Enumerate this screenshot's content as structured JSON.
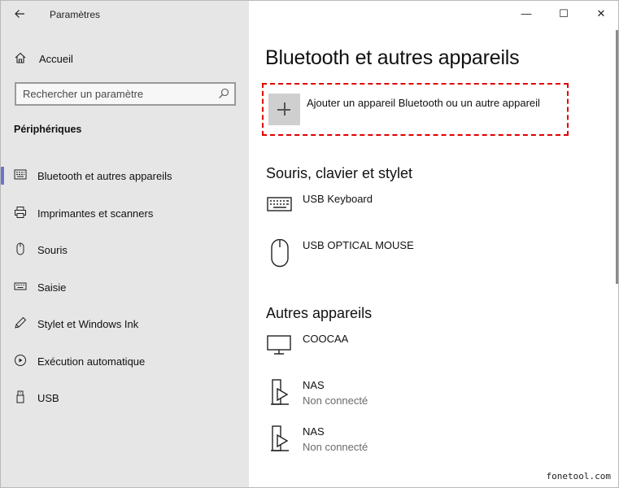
{
  "window": {
    "app_title": "Paramètres",
    "controls": {
      "minimize": "—",
      "maximize": "☐",
      "close": "✕"
    }
  },
  "sidebar": {
    "home_label": "Accueil",
    "search_placeholder": "Rechercher un paramètre",
    "section_label": "Périphériques",
    "items": [
      {
        "label": "Bluetooth et autres appareils",
        "icon": "bluetooth-devices-icon",
        "active": true
      },
      {
        "label": "Imprimantes et scanners",
        "icon": "printer-icon",
        "active": false
      },
      {
        "label": "Souris",
        "icon": "mouse-icon",
        "active": false
      },
      {
        "label": "Saisie",
        "icon": "keyboard-icon",
        "active": false
      },
      {
        "label": "Stylet et Windows Ink",
        "icon": "pen-icon",
        "active": false
      },
      {
        "label": "Exécution automatique",
        "icon": "autoplay-icon",
        "active": false
      },
      {
        "label": "USB",
        "icon": "usb-icon",
        "active": false
      }
    ],
    "active_color": "#6b75c9"
  },
  "main": {
    "title": "Bluetooth et autres appareils",
    "add_device_label": "Ajouter un appareil Bluetooth ou un autre appareil",
    "highlight_color": "#e00000",
    "groups": [
      {
        "title": "Souris, clavier et stylet",
        "devices": [
          {
            "name": "USB Keyboard",
            "status": "",
            "icon": "keyboard-icon"
          },
          {
            "name": "USB OPTICAL MOUSE",
            "status": "",
            "icon": "mouse-icon"
          }
        ]
      },
      {
        "title": "Autres appareils",
        "devices": [
          {
            "name": "COOCAA",
            "status": "",
            "icon": "monitor-icon"
          },
          {
            "name": "NAS",
            "status": "Non connecté",
            "icon": "media-device-icon"
          },
          {
            "name": "NAS",
            "status": "Non connecté",
            "icon": "media-device-icon"
          }
        ]
      }
    ]
  },
  "watermark": "fonetool.com"
}
